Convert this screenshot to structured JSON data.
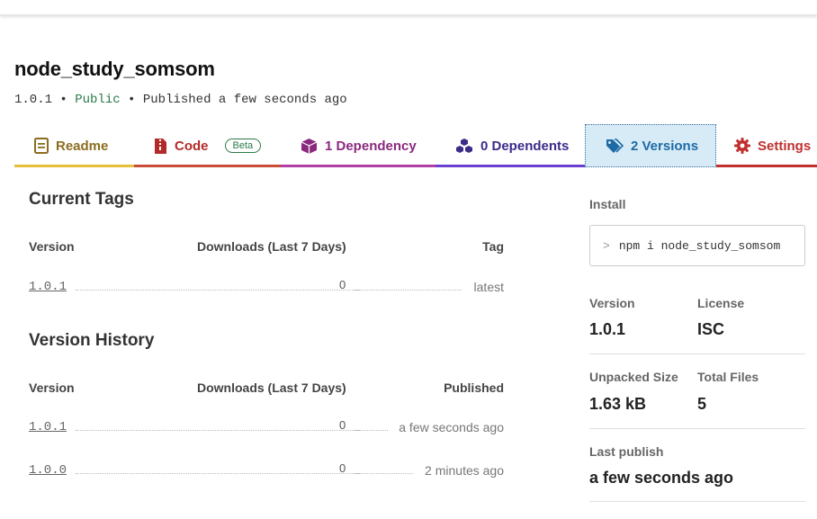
{
  "package": {
    "name": "node_study_somsom",
    "version": "1.0.1",
    "sep1": " • ",
    "visibility": "Public",
    "sep2": " • ",
    "published": "Published a few seconds ago"
  },
  "tabs": {
    "readme": "Readme",
    "code": "Code",
    "code_badge": "Beta",
    "dependencies": "1 Dependency",
    "dependents": "0 Dependents",
    "versions": "2 Versions",
    "settings": "Settings"
  },
  "current_tags": {
    "title": "Current Tags",
    "headers": {
      "version": "Version",
      "downloads": "Downloads (Last 7 Days)",
      "tag": "Tag"
    },
    "rows": [
      {
        "version": "1.0.1",
        "downloads": "0",
        "tag": "latest"
      }
    ]
  },
  "version_history": {
    "title": "Version History",
    "headers": {
      "version": "Version",
      "downloads": "Downloads (Last 7 Days)",
      "published": "Published"
    },
    "rows": [
      {
        "version": "1.0.1",
        "downloads": "0",
        "published": "a few seconds ago"
      },
      {
        "version": "1.0.0",
        "downloads": "0",
        "published": "2 minutes ago"
      }
    ]
  },
  "sidebar": {
    "install_label": "Install",
    "install_prompt": ">",
    "install_command": "npm i node_study_somsom",
    "version_label": "Version",
    "version_value": "1.0.1",
    "license_label": "License",
    "license_value": "ISC",
    "unpacked_size_label": "Unpacked Size",
    "unpacked_size_value": "1.63 kB",
    "total_files_label": "Total Files",
    "total_files_value": "5",
    "last_publish_label": "Last publish",
    "last_publish_value": "a few seconds ago"
  },
  "colors": {
    "readme": "#e5bf3b",
    "code": "#c94d35",
    "dependency": "#b13fa3",
    "dependents": "#6b3fd1",
    "versions": "#1e6aa5",
    "settings": "#c0302f",
    "public": "#2a7a47"
  },
  "icons": {
    "readme": "document-icon",
    "code": "zip-file-icon",
    "dependency": "cube-icon",
    "dependents": "cubes-icon",
    "versions": "tags-icon",
    "settings": "gear-icon",
    "install": "prompt-icon"
  }
}
